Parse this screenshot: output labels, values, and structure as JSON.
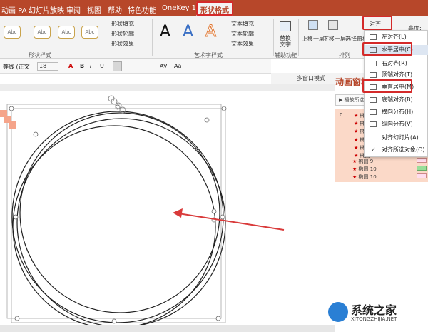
{
  "tabs": [
    "动画 PA",
    "幻灯片放映",
    "审阅",
    "视图",
    "帮助",
    "特色功能",
    "OneKey 10",
    "形状格式"
  ],
  "ribbon": {
    "style_sample": "Abc",
    "fill": "形状填充",
    "outline": "形状轮廓",
    "effect": "形状效果",
    "group_shape_style": "形状样式",
    "wordart_letter": "A",
    "text_fill": "文本填充",
    "text_outline": "文本轮廓",
    "text_effect": "文本效果",
    "group_wordart": "艺术字样式",
    "alt_text": "替换文字",
    "group_accessibility": "辅助功能",
    "bring_forward": "上移一层",
    "send_backward": "下移一层",
    "selection_pane": "选择窗格",
    "group_arrange": "排列",
    "align_button": "对齐",
    "height_label": "高度:"
  },
  "format_bar": {
    "font": "等线 (正文",
    "size": "18",
    "bold": "B",
    "italic": "I",
    "underline": "U",
    "spacing": "AV",
    "case": "Aa"
  },
  "panel": {
    "multiwin": "多窗口模式",
    "anim_title": "动画窗格",
    "play": "播放所选项",
    "first_index": "0"
  },
  "anim_items": [
    "椭圆",
    "椭圆",
    "椭圆",
    "椭圆",
    "椭圆",
    "椭圆",
    "椭圆 9",
    "椭圆 10",
    "椭圆 10"
  ],
  "align_menu": [
    {
      "label": "左对齐(L)",
      "icon": "align-left-icon",
      "highlight": false
    },
    {
      "label": "水平居中(C)",
      "icon": "align-center-icon",
      "highlight": true
    },
    {
      "label": "右对齐(R)",
      "icon": "align-right-icon",
      "highlight": false
    },
    {
      "label": "顶端对齐(T)",
      "icon": "align-top-icon",
      "highlight": false
    },
    {
      "label": "垂直居中(M)",
      "icon": "align-middle-icon",
      "highlight": false
    },
    {
      "label": "底端对齐(B)",
      "icon": "align-bottom-icon",
      "highlight": false
    },
    {
      "label": "横向分布(H)",
      "icon": "distribute-h-icon",
      "highlight": false
    },
    {
      "label": "纵向分布(V)",
      "icon": "distribute-v-icon",
      "highlight": false
    },
    {
      "label": "对齐幻灯片(A)",
      "icon": "",
      "highlight": false
    },
    {
      "label": "对齐所选对象(O)",
      "icon": "check-icon",
      "highlight": false
    }
  ],
  "watermark": {
    "brand": "系统之家",
    "url": "XITONGZHIJIA.NET"
  },
  "colors": {
    "accent": "#b7472a",
    "highlight_box": "#d42a2a",
    "arrow": "#d93a3a",
    "anim_bg": "#fbd9c8"
  }
}
